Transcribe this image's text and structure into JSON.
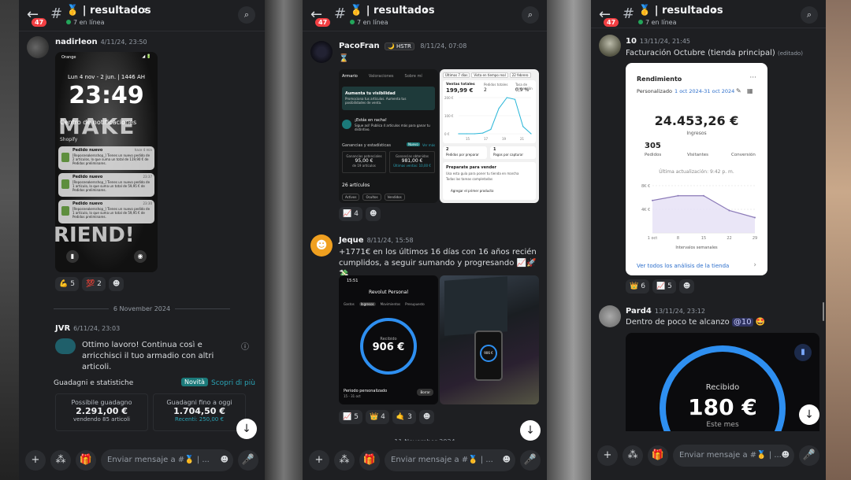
{
  "channel": {
    "title": "🥇 | resultados",
    "online": "7 en línea",
    "badge": "47"
  },
  "input_placeholder": "Enviar mensaje a #🥇 | ...",
  "colors": {
    "bg": "#1e1f22",
    "accent": "#5865f2",
    "online": "#23a55a",
    "mention": "#5865f2"
  },
  "panel1": {
    "msg1": {
      "user": "nadirleon",
      "time": "4/11/24, 23:50"
    },
    "phone": {
      "carrier": "Orange",
      "status": "◢ 🔋",
      "date": "Lun 4 nov - 2 jun. | 1446 AH",
      "clock": "23:49",
      "notif_center": "Centro de notificaciones",
      "shopify": "Shopify",
      "notifs": [
        {
          "title": "Pedido nuevo",
          "time": "hace 4 min",
          "body": "[Reposneakersshop_] Tienes un nuevo pedido de 2 artículos, lo que suma un total de 119,90 € de Pedidos preliminares."
        },
        {
          "title": "Pedido nuevo",
          "time": "23:37",
          "body": "[Reposneakersshop_] Tienes un nuevo pedido de 1 artículo, lo que suma un total de 59,95 € de Pedidos preliminares."
        },
        {
          "title": "Pedido nuevo",
          "time": "23:30",
          "body": "[Reposneakersshop_] Tienes un nuevo pedido de 1 artículo, lo que suma un total de 59,95 € de Pedidos preliminares."
        }
      ],
      "bg_top": "MAKE",
      "bg_bottom": "RIEND!"
    },
    "reactions1": [
      {
        "emoji": "💪",
        "count": "5"
      },
      {
        "emoji": "💯",
        "count": "2"
      },
      {
        "emoji": "☻",
        "count": ""
      }
    ],
    "date_divider": "6 November 2024",
    "msg2": {
      "user": "JVR",
      "time": "6/11/24, 23:03",
      "text": "Ottimo lavoro! Continua così e arricchisci il tuo armadio con altri articoli.",
      "stats_title": "Guadagni e statistiche",
      "novita": "Novità",
      "scopri": "Scopri di più",
      "box1_label": "Possibile guadagno",
      "box1_value": "2.291,00 €",
      "box1_sub": "vendendo 85 articoli",
      "box2_label": "Guadagni fino a oggi",
      "box2_value": "1.704,50 €",
      "box2_sub": "Recenti: 250,00 €"
    }
  },
  "panel2": {
    "msg1": {
      "user": "PacoFran",
      "tag": "🌙 HSTR",
      "time": "8/11/24, 07:08",
      "text": "⌛"
    },
    "vinted": {
      "tabs": [
        "Armario",
        "Valoraciones",
        "Sobre mí"
      ],
      "visibility_title": "Aumenta tu visibilidad",
      "visibility_text": "Promociona tus artículos. Aumenta tus posibilidades de venta.",
      "streak_title": "¡Estás en racha!",
      "streak_text": "Sigue así! Publica 4 artículos más para ganar tu distintivo.",
      "stats_label": "Ganancias y estadísticas",
      "nuevo": "Nuevo",
      "ver_mas": "Ver más",
      "pot_label": "Ganancias potenciales",
      "pot_value": "95,00 €",
      "pot_sub": "de 19 artículos",
      "obt_label": "Ganancias obtenidas",
      "obt_value": "981,00 €",
      "obt_sub": "Últimas ventas: 10,00 €",
      "articles": "26 artículos",
      "filters": [
        "Activos",
        "Ocultos",
        "Vendidos"
      ]
    },
    "shopify_mini": {
      "pills": [
        "Últimos 7 días",
        "Vista en tiempo real",
        "22 febrero"
      ],
      "ventas_label": "Ventas totales",
      "ventas_value": "199,99 €",
      "pedidos_label": "Pedidos totales",
      "pedidos_value": "2",
      "conv_label": "Tasa de conversión",
      "conv_value": "0,9 %",
      "y_ticks": [
        "200 €",
        "100 €",
        "0 €"
      ],
      "x_ticks": [
        "15",
        "17",
        "19",
        "21"
      ],
      "chart_values": [
        0,
        0,
        0,
        2,
        12,
        70,
        100,
        95,
        20,
        0
      ],
      "orders_a": "2",
      "orders_a_label": "Pedidos por preparar",
      "orders_b": "1",
      "orders_b_label": "Pagos por capturar",
      "prep_title": "Preparate para vender",
      "prep_text": "Usa esta guía para poner tu tienda en marcha",
      "prep_sub": "Todas las tareas completadas",
      "prep_item": "Agregar el primer producto"
    },
    "reactions1": [
      {
        "emoji": "📈",
        "count": "4"
      },
      {
        "emoji": "☻",
        "count": ""
      }
    ],
    "msg2": {
      "user": "Jeque",
      "time": "8/11/24, 15:58",
      "text": "+1771€ en los últimos 16 días con 16 años recién cumplidos, a seguir sumando y progresando 📈🚀💸"
    },
    "revolut": {
      "time": "15:51",
      "title": "Revolut Personal",
      "tabs": [
        "Gastos",
        "Ingresos",
        "Movimientos",
        "Presupuesto"
      ],
      "ring_label": "Recibido",
      "ring_value": "906 €",
      "period": "Periodo personalizado",
      "period_sub": "15 - 31 oct",
      "btn": "Borrar",
      "photo_value": "906 €"
    },
    "reactions2": [
      {
        "emoji": "📈",
        "count": "5"
      },
      {
        "emoji": "👑",
        "count": "4"
      },
      {
        "emoji": "🤙",
        "count": "3"
      },
      {
        "emoji": "☻",
        "count": ""
      }
    ],
    "date_divider": "11 November 2024"
  },
  "panel3": {
    "msg1": {
      "user": "10",
      "time": "13/11/24, 21:45",
      "text": "Facturación Octubre (tienda principal)",
      "edited": "(editado)"
    },
    "rendimiento": {
      "title": "Rendimiento",
      "period_label": "Personalizado",
      "period_range": "1 oct 2024-31 oct 2024",
      "total": "24.453,26 €",
      "total_label": "Ingresos",
      "pedidos": "305",
      "pedidos_label": "Pedidos",
      "visitantes_label": "Visitantes",
      "conversion_label": "Conversión",
      "updated": "Última actualización: 9:42 p. m.",
      "y_ticks": [
        "8K €",
        "4K €"
      ],
      "x_ticks": [
        "1 oct",
        "8",
        "15",
        "22",
        "29"
      ],
      "x_label": "Intervalos semanales",
      "chart_values": [
        5.5,
        6.3,
        6.3,
        3.8,
        2.6
      ],
      "link": "Ver todos los análisis de la tienda"
    },
    "reactions1": [
      {
        "emoji": "👑",
        "count": "6"
      },
      {
        "emoji": "📈",
        "count": "5"
      },
      {
        "emoji": "☻",
        "count": ""
      }
    ],
    "msg2": {
      "user": "Pard4",
      "time": "13/11/24, 23:12",
      "text": "Dentro de poco te alcanzo",
      "mention": "@10",
      "emoji": "🤩"
    },
    "revolut_big": {
      "label": "Recibido",
      "value": "180 €",
      "sub": "Este mes",
      "progress": 0.85
    }
  }
}
